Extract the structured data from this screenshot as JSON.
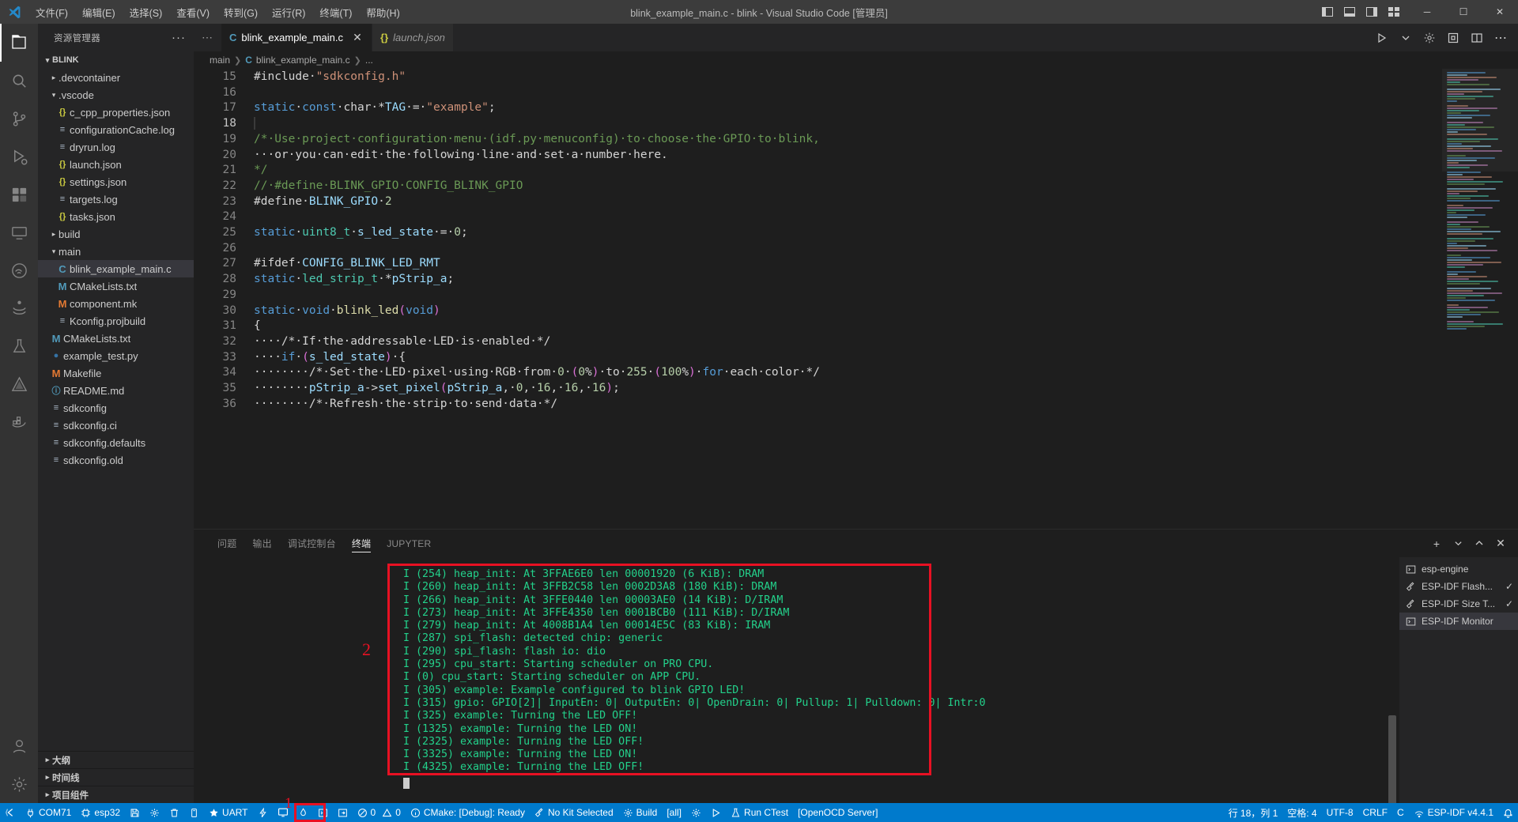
{
  "titlebar": {
    "logo_icon": "vscode-logo-icon",
    "menus": [
      "文件(F)",
      "编辑(E)",
      "选择(S)",
      "查看(V)",
      "转到(G)",
      "运行(R)",
      "终端(T)",
      "帮助(H)"
    ],
    "title": "blink_example_main.c - blink - Visual Studio Code [管理员]",
    "layout_icons": [
      "panel-left-icon",
      "panel-bottom-icon",
      "panel-right-icon",
      "customize-layout-icon"
    ],
    "window_controls": {
      "minimize": "─",
      "maximize": "☐",
      "close": "✕"
    }
  },
  "activitybar": {
    "items": [
      {
        "name": "explorer",
        "icon": "files-icon",
        "active": true
      },
      {
        "name": "search",
        "icon": "search-icon",
        "active": false
      },
      {
        "name": "source-control",
        "icon": "source-control-icon",
        "active": false
      },
      {
        "name": "run-debug",
        "icon": "run-debug-icon",
        "active": false
      },
      {
        "name": "extensions",
        "icon": "extensions-icon",
        "active": false
      },
      {
        "name": "remote-explorer",
        "icon": "remote-explorer-icon",
        "active": false
      },
      {
        "name": "espressif-idf",
        "icon": "espressif-icon",
        "active": false
      },
      {
        "name": "jupyter",
        "icon": "jupyter-icon",
        "active": false
      },
      {
        "name": "testing",
        "icon": "beaker-icon",
        "active": false
      },
      {
        "name": "cmake",
        "icon": "cmake-icon",
        "active": false
      },
      {
        "name": "docker",
        "icon": "docker-icon",
        "active": false
      }
    ],
    "bottom": [
      {
        "name": "accounts",
        "icon": "account-icon"
      },
      {
        "name": "manage",
        "icon": "gear-icon"
      }
    ]
  },
  "sidebar": {
    "title": "资源管理器",
    "more_actions": "···",
    "root": {
      "label": "BLINK",
      "expanded": true
    },
    "tree": [
      {
        "label": ".devcontainer",
        "type": "folder",
        "indent": 1,
        "expanded": false
      },
      {
        "label": ".vscode",
        "type": "folder",
        "indent": 1,
        "expanded": true
      },
      {
        "label": "c_cpp_properties.json",
        "type": "json",
        "indent": 2
      },
      {
        "label": "configurationCache.log",
        "type": "log",
        "indent": 2
      },
      {
        "label": "dryrun.log",
        "type": "log",
        "indent": 2
      },
      {
        "label": "launch.json",
        "type": "json",
        "indent": 2
      },
      {
        "label": "settings.json",
        "type": "json",
        "indent": 2
      },
      {
        "label": "targets.log",
        "type": "log",
        "indent": 2
      },
      {
        "label": "tasks.json",
        "type": "json",
        "indent": 2
      },
      {
        "label": "build",
        "type": "folder",
        "indent": 1,
        "expanded": false
      },
      {
        "label": "main",
        "type": "folder",
        "indent": 1,
        "expanded": true
      },
      {
        "label": "blink_example_main.c",
        "type": "c",
        "indent": 2,
        "selected": true
      },
      {
        "label": "CMakeLists.txt",
        "type": "m",
        "indent": 2
      },
      {
        "label": "component.mk",
        "type": "mk",
        "indent": 2
      },
      {
        "label": "Kconfig.projbuild",
        "type": "log",
        "indent": 2
      },
      {
        "label": "CMakeLists.txt",
        "type": "m",
        "indent": 1
      },
      {
        "label": "example_test.py",
        "type": "py",
        "indent": 1
      },
      {
        "label": "Makefile",
        "type": "mk",
        "indent": 1
      },
      {
        "label": "README.md",
        "type": "md",
        "indent": 1
      },
      {
        "label": "sdkconfig",
        "type": "log",
        "indent": 1
      },
      {
        "label": "sdkconfig.ci",
        "type": "log",
        "indent": 1
      },
      {
        "label": "sdkconfig.defaults",
        "type": "log",
        "indent": 1
      },
      {
        "label": "sdkconfig.old",
        "type": "log",
        "indent": 1
      }
    ],
    "bottom_sections": [
      "大纲",
      "时间线",
      "项目组件"
    ]
  },
  "editor": {
    "tabs": [
      {
        "label": "blink_example_main.c",
        "icon": "c-file-icon",
        "active": true,
        "closable": true,
        "italic": false
      },
      {
        "label": "launch.json",
        "icon": "json-file-icon",
        "active": false,
        "closable": false,
        "italic": true
      }
    ],
    "tab_actions": [
      "run-with-debug-icon",
      "chevron-down-icon",
      "settings-gear-icon",
      "esp-flash-icon",
      "split-editor-icon",
      "more-actions-icon"
    ],
    "breadcrumb": [
      "main",
      "blink_example_main.c",
      "..."
    ],
    "first_visible_line": 15,
    "lines": [
      {
        "n": 15,
        "text": "#include \"sdkconfig.h\"",
        "clipped": true
      },
      {
        "n": 16,
        "text": ""
      },
      {
        "n": 17,
        "text": "static const char *TAG = \"example\";"
      },
      {
        "n": 18,
        "text": "",
        "current": true
      },
      {
        "n": 19,
        "text": "/* Use project configuration menu (idf.py menuconfig) to choose the GPIO to blink,"
      },
      {
        "n": 20,
        "text": "   or you can edit the following line and set a number here."
      },
      {
        "n": 21,
        "text": "*/"
      },
      {
        "n": 22,
        "text": "// #define BLINK_GPIO CONFIG_BLINK_GPIO"
      },
      {
        "n": 23,
        "text": "#define BLINK_GPIO 2"
      },
      {
        "n": 24,
        "text": ""
      },
      {
        "n": 25,
        "text": "static uint8_t s_led_state = 0;"
      },
      {
        "n": 26,
        "text": ""
      },
      {
        "n": 27,
        "text": "#ifdef CONFIG_BLINK_LED_RMT"
      },
      {
        "n": 28,
        "text": "static led_strip_t *pStrip_a;"
      },
      {
        "n": 29,
        "text": ""
      },
      {
        "n": 30,
        "text": "static void blink_led(void)"
      },
      {
        "n": 31,
        "text": "{"
      },
      {
        "n": 32,
        "text": "    /* If the addressable LED is enabled */"
      },
      {
        "n": 33,
        "text": "    if (s_led_state) {"
      },
      {
        "n": 34,
        "text": "        /* Set the LED pixel using RGB from 0 (0%) to 255 (100%) for each color */"
      },
      {
        "n": 35,
        "text": "        pStrip_a->set_pixel(pStrip_a, 0, 16, 16, 16);"
      },
      {
        "n": 36,
        "text": "        /* Refresh the strip to send data */"
      }
    ]
  },
  "panel": {
    "tabs": [
      "问题",
      "输出",
      "调试控制台",
      "终端",
      "JUPYTER"
    ],
    "active_tab": "终端",
    "actions": [
      "new-terminal-icon",
      "chevron-down-icon",
      "maximize-panel-icon",
      "close-panel-icon"
    ],
    "annotation_marker": "2",
    "terminal_lines": [
      "I (254) heap_init: At 3FFAE6E0 len 00001920 (6 KiB): DRAM",
      "I (260) heap_init: At 3FFB2C58 len 0002D3A8 (180 KiB): DRAM",
      "I (266) heap_init: At 3FFE0440 len 00003AE0 (14 KiB): D/IRAM",
      "I (273) heap_init: At 3FFE4350 len 0001BCB0 (111 KiB): D/IRAM",
      "I (279) heap_init: At 4008B1A4 len 00014E5C (83 KiB): IRAM",
      "I (287) spi_flash: detected chip: generic",
      "I (290) spi_flash: flash io: dio",
      "I (295) cpu_start: Starting scheduler on PRO CPU.",
      "I (0) cpu_start: Starting scheduler on APP CPU.",
      "I (305) example: Example configured to blink GPIO LED!",
      "I (315) gpio: GPIO[2]| InputEn: 0| OutputEn: 0| OpenDrain: 0| Pullup: 1| Pulldown: 0| Intr:0",
      "I (325) example: Turning the LED OFF!",
      "I (1325) example: Turning the LED ON!",
      "I (2325) example: Turning the LED OFF!",
      "I (3325) example: Turning the LED ON!",
      "I (4325) example: Turning the LED OFF!"
    ],
    "terminal_list": [
      {
        "label": "esp-engine",
        "icon": "terminal-icon",
        "active": false,
        "check": ""
      },
      {
        "label": "ESP-IDF Flash...",
        "icon": "tools-icon",
        "active": false,
        "check": "✓"
      },
      {
        "label": "ESP-IDF Size T...",
        "icon": "tools-icon",
        "active": false,
        "check": "✓"
      },
      {
        "label": "ESP-IDF Monitor",
        "icon": "terminal-icon",
        "active": true,
        "check": ""
      }
    ]
  },
  "statusbar": {
    "annotation_marker": "1",
    "left_items": [
      {
        "name": "remote-indicator",
        "icon": "remote-icon",
        "label": ""
      },
      {
        "name": "serial-port",
        "icon": "plug-icon",
        "label": "COM71"
      },
      {
        "name": "target-chip",
        "icon": "chip-icon",
        "label": "esp32"
      },
      {
        "name": "save-flash",
        "icon": "save-icon",
        "label": ""
      },
      {
        "name": "menuconfig",
        "icon": "gear-icon",
        "label": ""
      },
      {
        "name": "full-clean",
        "icon": "trash-icon",
        "label": ""
      },
      {
        "name": "flash-device",
        "icon": "flash-device-icon",
        "label": ""
      },
      {
        "name": "flash-method",
        "icon": "star-icon",
        "label": "UART"
      },
      {
        "name": "build-flash-monitor",
        "icon": "lightning-icon",
        "label": ""
      },
      {
        "name": "monitor-device",
        "icon": "monitor-icon",
        "label": "",
        "highlighted": true
      },
      {
        "name": "idf-debug",
        "icon": "flame-icon",
        "label": ""
      },
      {
        "name": "open-terminal",
        "icon": "terminal-icon",
        "label": ""
      },
      {
        "name": "idf-qemu",
        "icon": "qemu-icon",
        "label": ""
      },
      {
        "name": "problems",
        "icon": "error-warning-icon",
        "label": "0 0",
        "errors": "0",
        "warnings": "0"
      },
      {
        "name": "cmake-status",
        "icon": "info-icon",
        "label": "CMake: [Debug]: Ready"
      },
      {
        "name": "kit-selector",
        "icon": "tools-icon",
        "label": "No Kit Selected"
      },
      {
        "name": "build-button",
        "icon": "gear-icon",
        "label": "Build"
      },
      {
        "name": "build-target",
        "icon": "",
        "label": "[all]"
      },
      {
        "name": "launch-target-settings",
        "icon": "settings-icon",
        "label": ""
      },
      {
        "name": "launch-button",
        "icon": "play-icon",
        "label": ""
      },
      {
        "name": "run-ctest",
        "icon": "beaker-icon",
        "label": "Run CTest"
      },
      {
        "name": "openocd-server",
        "icon": "",
        "label": "[OpenOCD Server]"
      }
    ],
    "right_items": [
      {
        "name": "cursor-position",
        "label": "行 18，列 1"
      },
      {
        "name": "indentation",
        "label": "空格: 4"
      },
      {
        "name": "encoding",
        "label": "UTF-8"
      },
      {
        "name": "eol",
        "label": "CRLF"
      },
      {
        "name": "language-mode",
        "label": "C"
      },
      {
        "name": "esp-idf-version",
        "icon": "espressif-icon",
        "label": "ESP-IDF v4.4.1"
      },
      {
        "name": "notifications",
        "icon": "bell-icon",
        "label": ""
      }
    ]
  },
  "colors": {
    "accent": "#007acc",
    "annotation_red": "#e81123",
    "terminal_green": "#23d18b",
    "titlebar_bg": "#3c3c3c",
    "sidebar_bg": "#252526",
    "editor_bg": "#1e1e1e",
    "activitybar_bg": "#333333"
  }
}
